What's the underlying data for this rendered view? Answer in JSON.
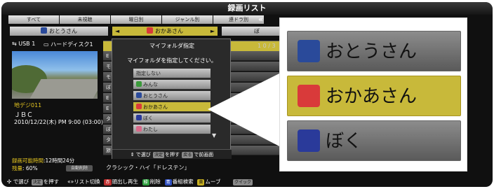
{
  "title": "録画リスト",
  "tabs": [
    "すべて",
    "未視聴",
    "曜日別",
    "ジャンル別",
    "連ドラ別"
  ],
  "tab_nav_symbol": "«",
  "folder_bar": {
    "left_arrow": "◄",
    "right_arrow": "►",
    "left_folder": "おとうさん",
    "current_folder": "おかあさん",
    "right_folder_partial": "ぼ"
  },
  "storage": {
    "usb": "USB 1",
    "hdd": "ハードディスク1",
    "page": "1 0 / 3"
  },
  "program": {
    "channel": "地デジ011",
    "station": "ＪＢＣ",
    "datetime": "2010/12/22(木) PM 9:00 (03:00)"
  },
  "remaining": {
    "time_label": "録画可能時間",
    "time_value": ":12時間24分",
    "pct_label": "残量",
    "pct_value": ":  60%",
    "auto_delete": "自動削除"
  },
  "list_rows": [
    "",
    "E",
    "モ",
    "モ",
    "ぼ",
    "E",
    "E",
    "タ",
    "ぼ",
    "タ",
    "旅"
  ],
  "classic_row": "クラシック・ハイ「ドレステン」",
  "dialog": {
    "title": "マイフォルダ指定",
    "message": "マイフォルダを指定してください。",
    "options": [
      {
        "label": "指定しない",
        "icon": ""
      },
      {
        "label": "みんな",
        "icon": "family-icon"
      },
      {
        "label": "おとうさん",
        "icon": "father-icon"
      },
      {
        "label": "おかあさん",
        "icon": "mother-icon"
      },
      {
        "label": "ぼく",
        "icon": "boy-icon"
      },
      {
        "label": "わたし",
        "icon": "girl-icon"
      }
    ],
    "selected_index": 3,
    "scroll_symbol": "▼",
    "hint": {
      "nav": "で選び",
      "enter_key": "決定",
      "enter_text": "を押す",
      "back_key": "戻る",
      "back_text": "で前画面"
    }
  },
  "bottom_bar": {
    "select": "で選び",
    "enter_key": "決定",
    "enter_text": "を押す",
    "switch": "リスト切換",
    "red_key": "赤",
    "red_text": "頭出し再生",
    "green_key": "緑",
    "green_text": "削除",
    "blue_key": "青",
    "blue_text": "番組検索",
    "yellow_key": "黄",
    "yellow_text": "ムーブ",
    "quick": "クイック"
  },
  "zoom": {
    "rows": [
      "おとうさん",
      "おかあさん",
      "ぼく"
    ],
    "selected_index": 1
  },
  "colors": {
    "highlight": "#c8b93a",
    "mother": "#d93a3a",
    "father": "#2a4a9a",
    "boy": "#2a3a9a"
  }
}
